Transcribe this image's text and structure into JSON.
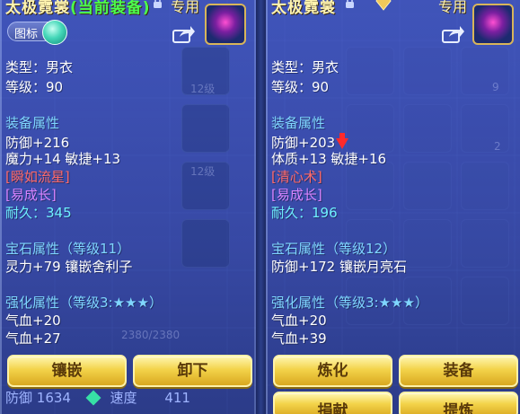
{
  "left_panel": {
    "title": "太极霓裳",
    "equipped_tag": "(当前装备)",
    "exclusive_label": "专用",
    "icon_toggle_label": "图标",
    "type_line": "类型：男衣",
    "level_line": "等级：90",
    "equip_attr_heading": "装备属性",
    "attr_lines": [
      "防御+216",
      "魔力+14 敏捷+13"
    ],
    "special_effect": "[瞬如流星]",
    "special_trait": "[易成长]",
    "durability": "耐久：345",
    "gem_heading": "宝石属性（等级11）",
    "gem_line": "灵力+79 镶嵌舍利子",
    "enhance_heading": "强化属性（等级3:★★★）",
    "enhance_lines": [
      "气血+20",
      "气血+27"
    ],
    "buttons": {
      "embed": "镶嵌",
      "unequip": "卸下"
    },
    "under_stats": {
      "label1": "防御",
      "value1": "1634",
      "label2": "速度",
      "value2": "411"
    }
  },
  "right_panel": {
    "title": "太极霓裳",
    "exclusive_label": "专用",
    "type_line": "类型：男衣",
    "level_line": "等级：90",
    "equip_attr_heading": "装备属性",
    "attr_lines": [
      "防御+203",
      "体质+13 敏捷+16"
    ],
    "special_effect": "[清心术]",
    "special_trait": "[易成长]",
    "durability": "耐久：196",
    "gem_heading": "宝石属性（等级12）",
    "gem_line": "防御+172 镶嵌月亮石",
    "enhance_heading": "强化属性（等级3:★★★）",
    "enhance_lines": [
      "气血+20",
      "气血+39"
    ],
    "buttons": {
      "refine": "炼化",
      "equip": "装备",
      "donate": "捐献",
      "upgrade": "提炼"
    }
  },
  "background": {
    "slot_labels": [
      "12级",
      "12级",
      "12级",
      "9",
      "2"
    ],
    "exp_text": "2380/2380"
  },
  "colors": {
    "title": "#fff4b0",
    "equipped": "#4cff4c",
    "heading": "#7fd6ff",
    "special_effect": "#ff6a6a",
    "special_trait": "#d884ff",
    "durability": "#6ff0ff",
    "button": "#f3d34a"
  }
}
